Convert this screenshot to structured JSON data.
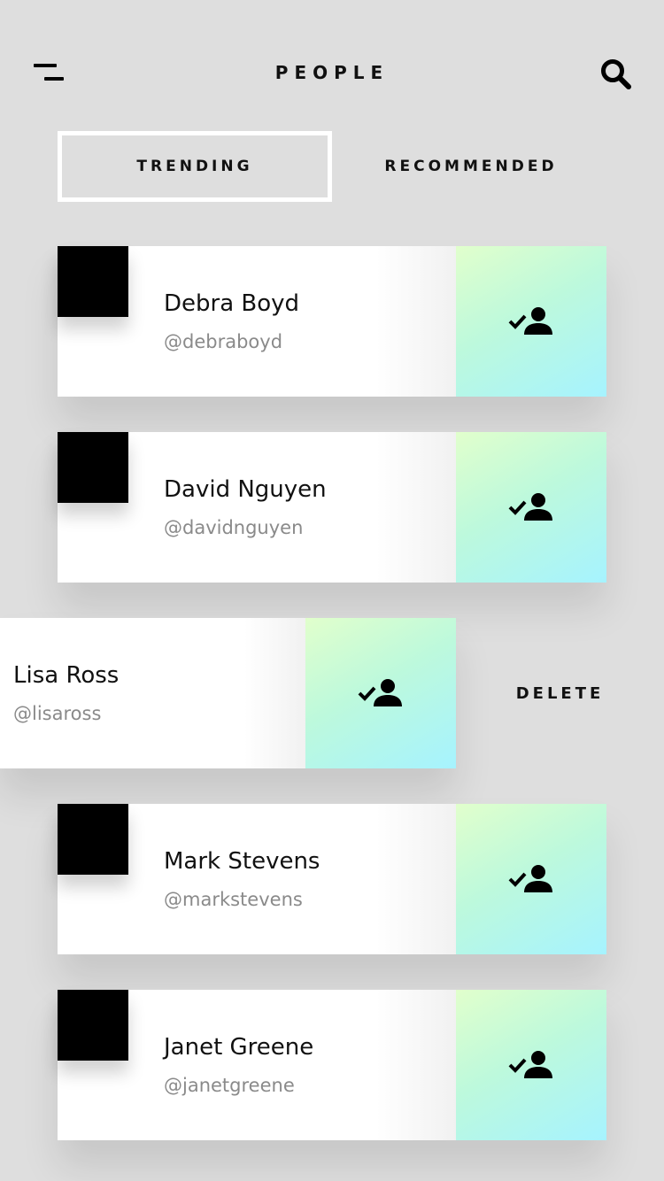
{
  "header": {
    "title": "PEOPLE",
    "menu_icon": "menu-icon",
    "search_icon": "search-icon"
  },
  "tabs": [
    {
      "label": "TRENDING",
      "active": true
    },
    {
      "label": "RECOMMENDED",
      "active": false
    }
  ],
  "people": [
    {
      "name": "Debra Boyd",
      "handle": "@debraboyd",
      "action_icon": "user-check-icon"
    },
    {
      "name": "David Nguyen",
      "handle": "@davidnguyen",
      "action_icon": "user-check-icon"
    },
    {
      "name": "Lisa Ross",
      "handle": "@lisaross",
      "action_icon": "user-check-icon",
      "swipe_action": "DELETE"
    },
    {
      "name": "Mark Stevens",
      "handle": "@markstevens",
      "action_icon": "user-check-icon"
    },
    {
      "name": "Janet Greene",
      "handle": "@janetgreene",
      "action_icon": "user-check-icon"
    }
  ],
  "colors": {
    "background": "#dedede",
    "card": "#ffffff",
    "follow_gradient_start": "#e1ffcc",
    "follow_gradient_end": "#a6f3ff",
    "handle_text": "#8a8a8a"
  }
}
